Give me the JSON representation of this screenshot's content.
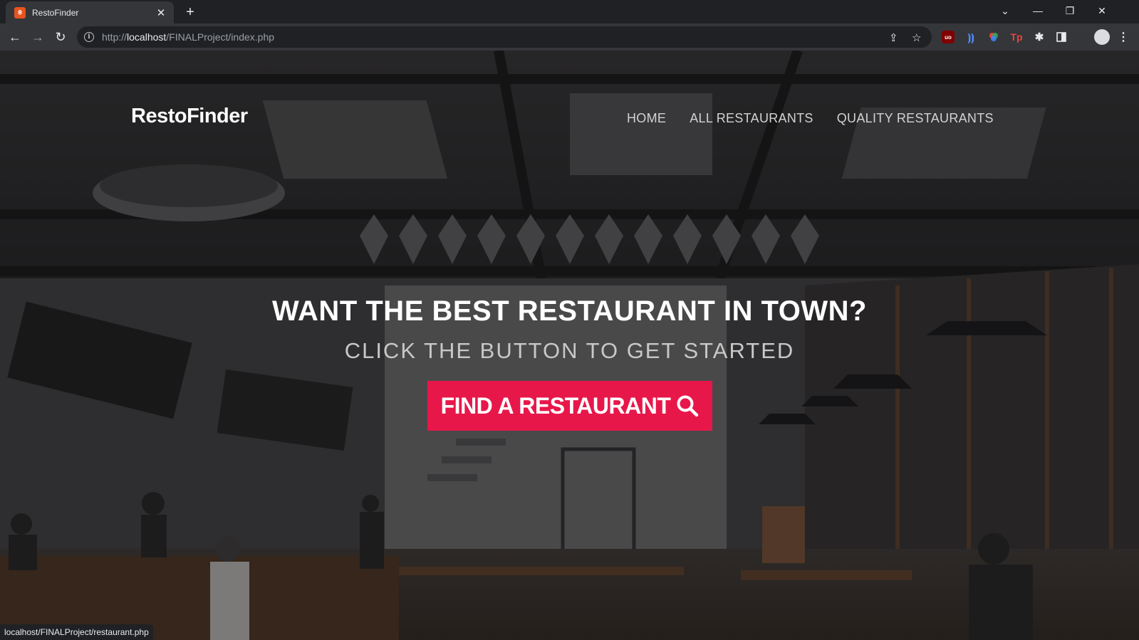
{
  "browser": {
    "tab_title": "RestoFinder",
    "tab_favicon": "xampp-icon",
    "url_scheme": "http://",
    "url_host": "localhost",
    "url_path": "/FINALProject/index.php"
  },
  "site": {
    "brand": "RestoFinder",
    "nav": [
      "HOME",
      "ALL RESTAURANTS",
      "QUALITY RESTAURANTS"
    ],
    "hero_title": "WANT THE BEST RESTAURANT IN TOWN?",
    "hero_subtitle": "CLICK THE BUTTON TO GET STARTED",
    "cta_label": "FIND A RESTAURANT",
    "cta_icon": "search-icon",
    "accent_color": "#e8174a"
  },
  "status_bar": "localhost/FINALProject/restaurant.php"
}
